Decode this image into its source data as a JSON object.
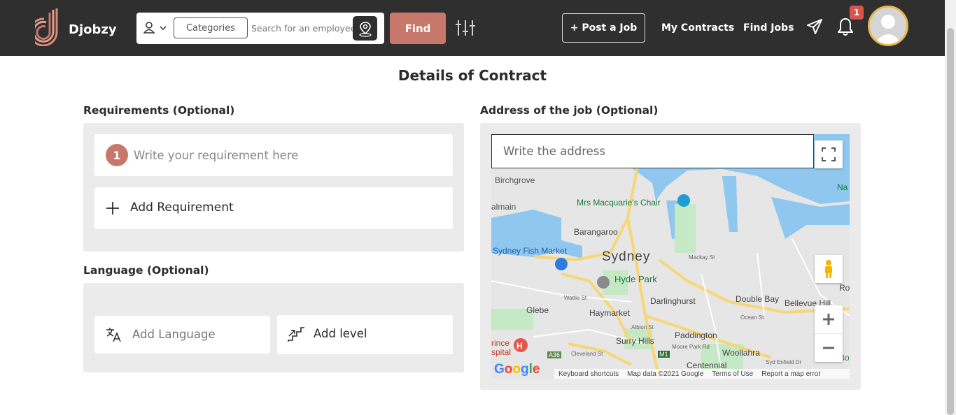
{
  "header": {
    "brand": "Djobzy",
    "search": {
      "categories_label": "Categories",
      "placeholder": "Search for an employee"
    },
    "find_label": "Find",
    "post_job_label": "+ Post a Job",
    "nav": [
      "My Contracts",
      "Find Jobs"
    ],
    "notification_count": "1"
  },
  "page": {
    "title": "Details of Contract",
    "requirements": {
      "label": "Requirements (Optional)",
      "item_number": "1",
      "placeholder": "Write your requirement here",
      "add_label": "Add Requirement"
    },
    "language": {
      "label": "Language (Optional)",
      "add_language": "Add Language",
      "add_level": "Add level"
    },
    "address": {
      "label": "Address of the job (Optional)",
      "placeholder": "Write the address"
    }
  },
  "map": {
    "places": [
      "Birchgrove",
      "almain",
      "Mrs Macquarie's Chair",
      "Barangaroo",
      "Sydney Fish Market",
      "Sydney",
      "Hyde Park",
      "Darlinghurst",
      "Double Bay",
      "Bellevue Hill",
      "Glebe",
      "Haymarket",
      "Surry Hills",
      "Paddington",
      "Woollahra",
      "Centennial",
      "rince",
      "spital",
      "Na",
      "Ro",
      "Bo"
    ],
    "roads": [
      "A36",
      "M1",
      "Albion St",
      "Moore Park Rd",
      "Cleveland St",
      "Syd Enfield Dr",
      "Ocean St",
      "Wattle St",
      "Mackay St"
    ],
    "footer": [
      "Keyboard shortcuts",
      "Map data ©2021 Google",
      "Terms of Use",
      "Report a map error"
    ],
    "logo": "Google"
  },
  "colors": {
    "header_bg": "#2f2f2f",
    "accent": "#c8786a",
    "avatar_ring": "#e9b64a",
    "badge": "#d9534f",
    "water": "#8fc7ef"
  }
}
